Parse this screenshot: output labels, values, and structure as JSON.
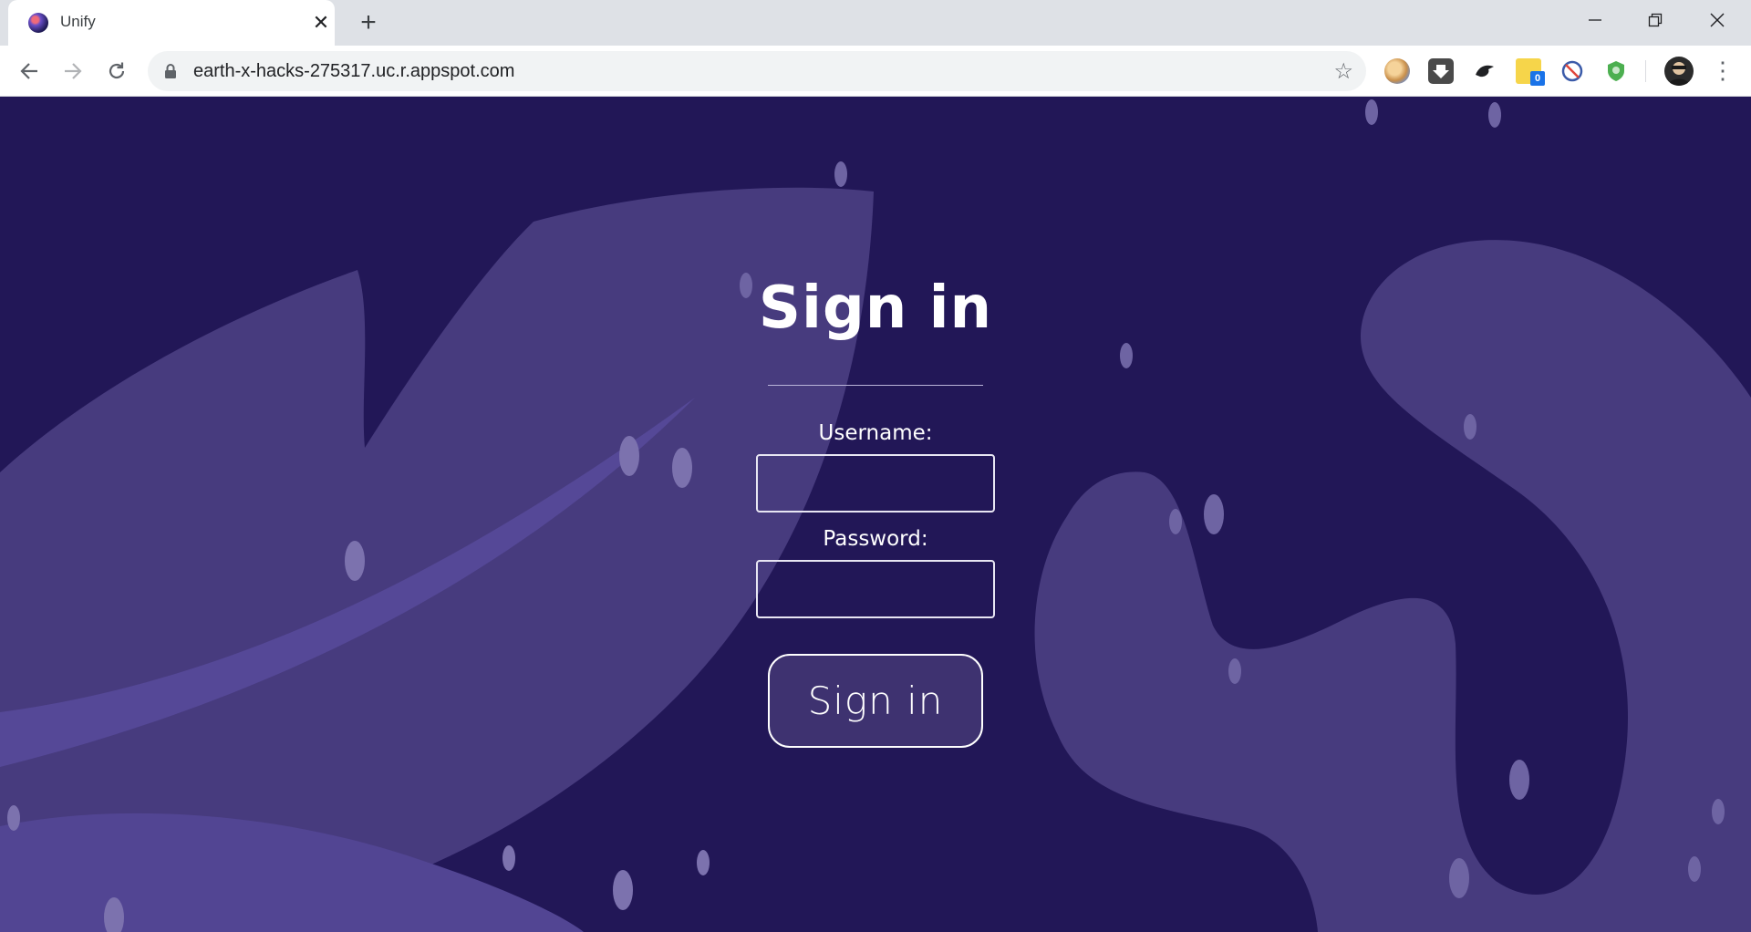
{
  "browser": {
    "tab": {
      "title": "Unify",
      "close_icon": "close-icon"
    },
    "new_tab_icon": "plus-icon",
    "window_controls": [
      "minimize-icon",
      "restore-icon",
      "close-icon"
    ],
    "address": "earth-x-hacks-275317.uc.r.appspot.com",
    "extensions": [
      "palette-icon",
      "download-icon",
      "bird-icon",
      "sticky-note-icon",
      "block-icon",
      "shield-icon"
    ],
    "extension_badge": "0"
  },
  "page": {
    "title": "Sign in",
    "username_label": "Username:",
    "password_label": "Password:",
    "username_value": "",
    "password_value": "",
    "submit_label": "Sign in",
    "background_color": "#221757",
    "shape_color": "#473b7e"
  }
}
